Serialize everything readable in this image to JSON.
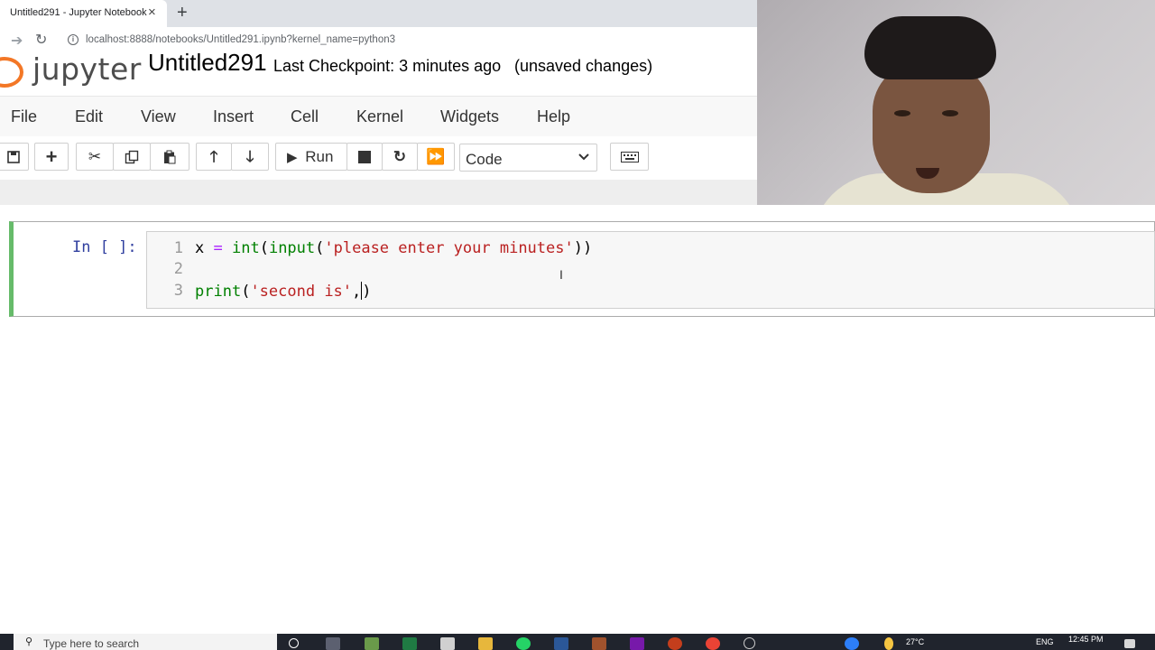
{
  "browser": {
    "tab_title": "Untitled291 - Jupyter Notebook",
    "tab_close": "×",
    "new_tab": "+",
    "url": "localhost:8888/notebooks/Untitled291.ipynb?kernel_name=python3"
  },
  "header": {
    "logo_text": "jupyter",
    "notebook_name": "Untitled291",
    "checkpoint": "Last Checkpoint: 3 minutes ago",
    "unsaved": "(unsaved changes)"
  },
  "menu": [
    "File",
    "Edit",
    "View",
    "Insert",
    "Cell",
    "Kernel",
    "Widgets",
    "Help"
  ],
  "toolbar": {
    "run_label": "Run",
    "cell_type": "Code"
  },
  "cell": {
    "prompt": "In [ ]:",
    "line_numbers": [
      "1",
      "2",
      "3"
    ],
    "lines": [
      {
        "p1": "x ",
        "p2": "=",
        "p3": " ",
        "p4": "int",
        "p5": "(",
        "p6": "input",
        "p7": "(",
        "p8": "'please enter your minutes'",
        "p9": "))"
      },
      {
        "p1": ""
      },
      {
        "p1": "print",
        "p2": "(",
        "p3": "'second is'",
        "p4": ","
      }
    ],
    "line3_tail": ")"
  },
  "taskbar": {
    "search_placeholder": "Type here to search",
    "temperature": "27°C",
    "language": "ENG",
    "time": "12:45 PM"
  },
  "colors": {
    "cell_selected_border": "#66bb6a",
    "jupyter_orange": "#f37726",
    "prompt_blue": "#303f9f"
  }
}
